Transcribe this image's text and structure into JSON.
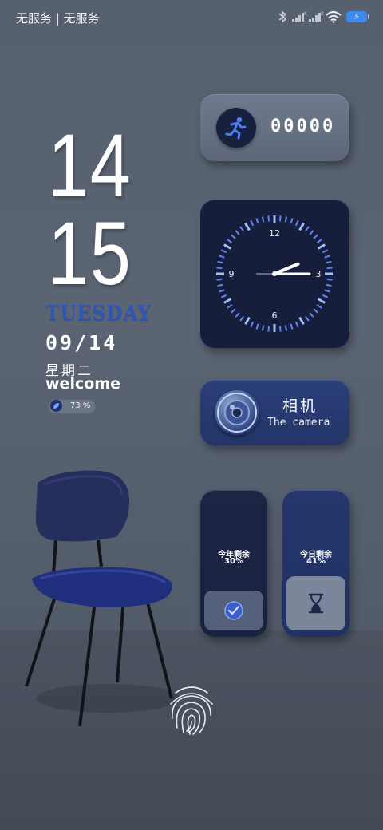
{
  "status_bar": {
    "carrier": "无服务 | 无服务",
    "icons": [
      "bluetooth-icon",
      "signal-icon",
      "signal-icon",
      "wifi-icon",
      "battery-charging-icon"
    ]
  },
  "clock": {
    "hour": "14",
    "minute": "15",
    "weekday_en": "TUESDAY",
    "date": "09/14",
    "weekday_cn": "星期二",
    "greeting": "welcome",
    "battery_label": "73 %",
    "battery_level": 0.73
  },
  "widgets": {
    "steps": {
      "icon": "running-person-icon",
      "count": "00000"
    },
    "analog_clock": {
      "numbers": [
        "12",
        "3",
        "6",
        "9"
      ],
      "hour": 14,
      "minute": 15
    },
    "camera": {
      "icon": "camera-lens-icon",
      "title": "相机",
      "subtitle": "The camera"
    },
    "year_progress": {
      "label": "今年剩余",
      "value": "30%",
      "icon": "clock-icon"
    },
    "day_progress": {
      "label": "今日剩余",
      "value": "41%",
      "icon": "hourglass-icon"
    }
  },
  "lock": {
    "icon": "fingerprint-icon"
  },
  "colors": {
    "background": "#56606f",
    "accent_blue": "#2d56b8",
    "clock_face": "#171e3b",
    "tick_blue": "#6f9bff"
  }
}
